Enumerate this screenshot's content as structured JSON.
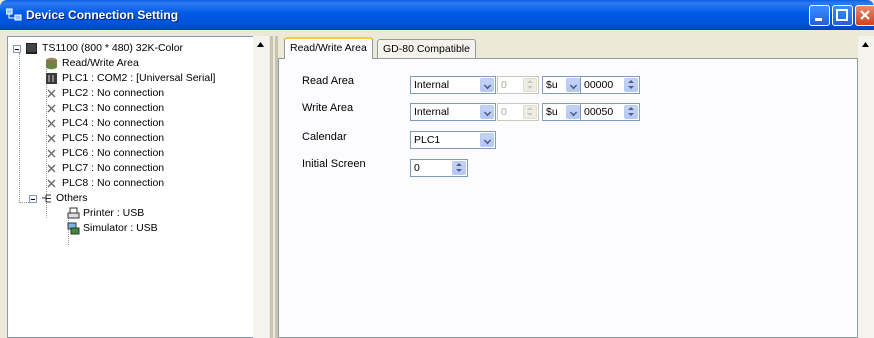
{
  "window": {
    "title": "Device Connection Setting"
  },
  "tree": {
    "root": "TS1100 (800 * 480) 32K-Color",
    "items": [
      {
        "label": "Read/Write Area",
        "icon": "database-icon"
      },
      {
        "label": "PLC1 : COM2 : [Universal Serial]",
        "icon": "plc-device-icon"
      },
      {
        "label": "PLC2 : No connection",
        "icon": "x-icon"
      },
      {
        "label": "PLC3 : No connection",
        "icon": "x-icon"
      },
      {
        "label": "PLC4 : No connection",
        "icon": "x-icon"
      },
      {
        "label": "PLC5 : No connection",
        "icon": "x-icon"
      },
      {
        "label": "PLC6 : No connection",
        "icon": "x-icon"
      },
      {
        "label": "PLC7 : No connection",
        "icon": "x-icon"
      },
      {
        "label": "PLC8 : No connection",
        "icon": "x-icon"
      }
    ],
    "others": {
      "label": "Others",
      "children": [
        {
          "label": "Printer : USB",
          "icon": "printer-icon"
        },
        {
          "label": "Simulator : USB",
          "icon": "simulator-icon"
        }
      ]
    }
  },
  "tabs": [
    {
      "label": "Read/Write Area",
      "active": true
    },
    {
      "label": "GD-80 Compatible",
      "active": false
    }
  ],
  "form": {
    "read_area": {
      "label": "Read Area",
      "memory": "Internal",
      "port": "0",
      "device": "$u",
      "address": "00000"
    },
    "write_area": {
      "label": "Write Area",
      "memory": "Internal",
      "port": "0",
      "device": "$u",
      "address": "00050"
    },
    "calendar": {
      "label": "Calendar",
      "value": "PLC1"
    },
    "initial_screen": {
      "label": "Initial Screen",
      "value": "0"
    }
  },
  "colors": {
    "titlebar": "#0058E6",
    "tab_highlight": "#FFC83C",
    "window_bg": "#ECE9D8"
  }
}
